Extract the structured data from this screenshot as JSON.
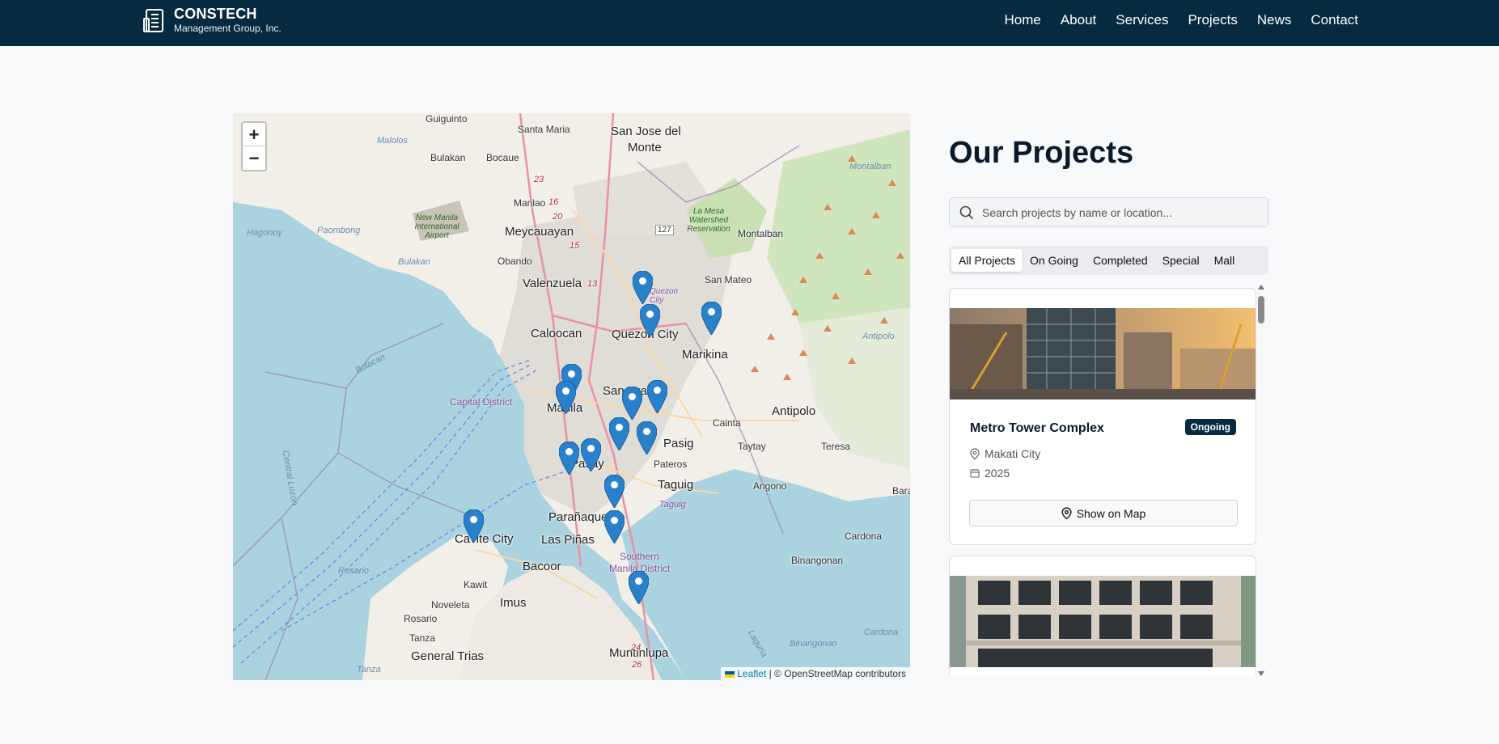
{
  "header": {
    "brand_title": "CONSTECH",
    "brand_subtitle": "Management Group, Inc.",
    "nav": [
      "Home",
      "About",
      "Services",
      "Projects",
      "News",
      "Contact"
    ]
  },
  "map": {
    "zoom_in": "+",
    "zoom_out": "−",
    "attribution_link": "Leaflet",
    "attribution_text": "| © OpenStreetMap contributors",
    "labels": {
      "guiguinto": "Guiguinto",
      "santa_maria": "Santa Maria",
      "san_jose": "San Jose del",
      "monte": "Monte",
      "malolos": "Malolos",
      "bulakan": "Bulakan",
      "bocaue": "Bocaue",
      "marilao": "Marilao",
      "meycauayan": "Meycauayan",
      "obando": "Obando",
      "valenzuela": "Valenzuela",
      "caloocan": "Caloocan",
      "quezon_city": "Quezon City",
      "marikina": "Marikina",
      "montalban": "Montalban",
      "san_mateo": "San Mateo",
      "manila": "Manila",
      "san_juan": "San Juan",
      "pasig": "Pasig",
      "pasay": "Pasay",
      "pateros": "Pateros",
      "taguig": "Taguig",
      "cainta": "Cainta",
      "antipolo": "Antipolo",
      "taytay": "Taytay",
      "teresa": "Teresa",
      "angono": "Angono",
      "baras": "Bara",
      "paranaque": "Parañaque",
      "las_pinas": "Las Piñas",
      "cavite_city": "Cavite City",
      "bacoor": "Bacoor",
      "kawit": "Kawit",
      "imus": "Imus",
      "noveleta": "Noveleta",
      "rosario_town": "Rosario",
      "tanza": "Tanza",
      "general_trias": "General Trias",
      "muntinlupa": "Muntinlupa",
      "cardona": "Cardona",
      "binangonan": "Binangonan",
      "hagonoy": "Hagonoy",
      "paombong": "Paombong",
      "bulakan_water": "Bulakan",
      "bulacan_water": "Bulacan",
      "central_luzon": "Central Luzon",
      "rosario_water": "Rosario",
      "capital_district": "Capital District",
      "southern_manila": "Southern",
      "southern_manila2": "Manila District",
      "laguna": "Laguna",
      "binangonan_water": "Binangonan",
      "cardona_water": "Cardona",
      "antipolo_region": "Antipolo",
      "montalban_region": "Montalban",
      "airport": "New Manila International Airport",
      "watershed": "La Mesa Watershed Reservation",
      "route_127": "127",
      "r23": "23",
      "r20": "20",
      "r15": "15",
      "r13": "13",
      "r16": "16",
      "r24": "24",
      "r26": "26",
      "tanza_water": "Tanza",
      "taguig_river": "Taguig",
      "quezon_purple": "Quezon City"
    }
  },
  "panel": {
    "title": "Our Projects",
    "search_placeholder": "Search projects by name or location...",
    "tabs": [
      "All Projects",
      "On Going",
      "Completed",
      "Special",
      "Mall"
    ],
    "active_tab": "All Projects"
  },
  "projects": [
    {
      "name": "Metro Tower Complex",
      "status": "Ongoing",
      "location": "Makati City",
      "year": "2025",
      "button": "Show on Map"
    }
  ],
  "colors": {
    "navy": "#062a40",
    "marker": "#2a81cb"
  }
}
